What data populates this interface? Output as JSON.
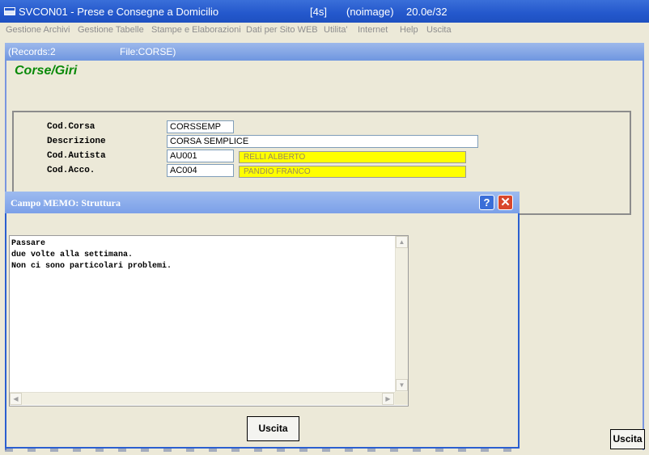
{
  "window": {
    "title": "SVCON01 - Prese e Consegne a Domicilio",
    "timer": "[4s]",
    "image_status": "(noimage)",
    "version": "20.0e/32"
  },
  "menu": {
    "items": [
      "Gestione Archivi",
      "Gestione Tabelle",
      "Stampe e Elaborazioni",
      "Dati per Sito WEB",
      "Utilita'",
      "Internet",
      "Help",
      "Uscita"
    ]
  },
  "status": {
    "records": "(Records:2",
    "file": "File:CORSE)"
  },
  "form": {
    "heading": "Corse/Giri",
    "fields": {
      "cod_corsa": {
        "label": "Cod.Corsa",
        "value": "CORSSEMP"
      },
      "descrizione": {
        "label": "Descrizione",
        "value": "CORSA SEMPLICE"
      },
      "cod_autista": {
        "label": "Cod.Autista",
        "value": "AU001",
        "lookup": "RELLI ALBERTO"
      },
      "cod_acco": {
        "label": "Cod.Acco.",
        "value": "AC004",
        "lookup": "PANDIO  FRANCO"
      }
    },
    "exit_label": "Uscita"
  },
  "memo_dialog": {
    "title": "Campo MEMO: Struttura",
    "help_label": "?",
    "close_label": "✕",
    "lines": [
      "Passare",
      "due volte alla settimana.",
      "Non ci sono particolari problemi."
    ],
    "exit_label": "Uscita",
    "scroll_icons": {
      "up": "▲",
      "down": "▼",
      "left": "◀",
      "right": "▶"
    }
  },
  "colors": {
    "titlebar": "#2458cc",
    "heading_green": "#0a8a0a",
    "lookup_yellow": "#ffff00",
    "close_red": "#d9472b"
  }
}
